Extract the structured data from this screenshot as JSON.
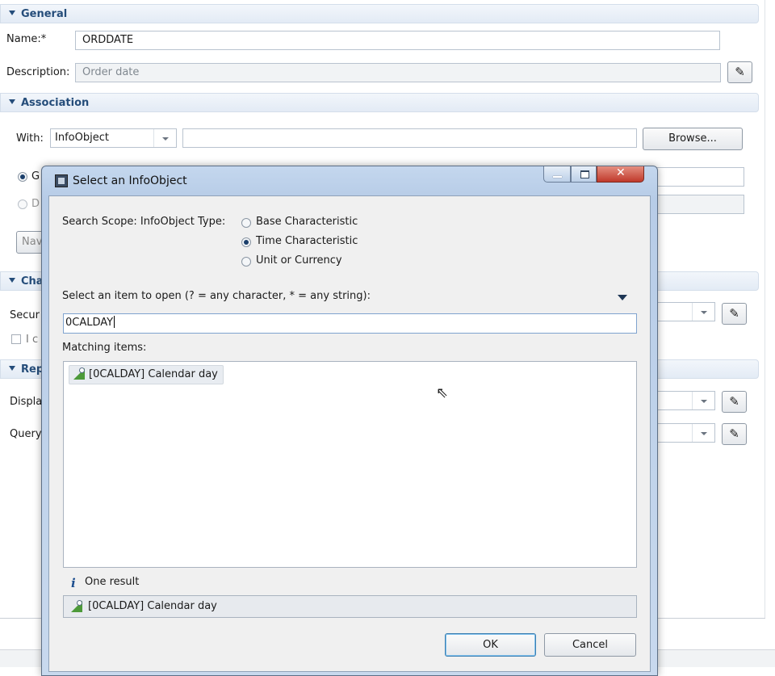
{
  "general": {
    "header": "General",
    "name_label": "Name:*",
    "name_value": "ORDDATE",
    "description_label": "Description:",
    "description_value": "Order date"
  },
  "association": {
    "header": "Association",
    "with_label": "With:",
    "with_value": "InfoObject",
    "browse_label": "Browse...",
    "radio1_partial": "G",
    "radio2_partial": "D",
    "nav_partial": "Nav"
  },
  "characteristics": {
    "header_partial": "Cha",
    "security_partial": "Secur",
    "checkbox_partial": "I c"
  },
  "reporting": {
    "header_partial": "Rep",
    "display_partial": "Displa",
    "query_partial": "Query"
  },
  "dialog": {
    "title": "Select an InfoObject",
    "search_scope_label": "Search Scope: InfoObject Type:",
    "scope_options": [
      "Base Characteristic",
      "Time Characteristic",
      "Unit or Currency"
    ],
    "scope_selected": "Time Characteristic",
    "pattern_label": "Select an item to open (? = any character, * = any string):",
    "pattern_value": "0CALDAY",
    "matching_label": "Matching items:",
    "matching_items": [
      "[0CALDAY] Calendar day"
    ],
    "status_text": "One result",
    "status_item": "[0CALDAY] Calendar day",
    "ok_label": "OK",
    "cancel_label": "Cancel"
  },
  "colors": {
    "section_header_text": "#254d7a",
    "dialog_frame": "#b7cce7",
    "item_icon": "#4d9a3a"
  }
}
